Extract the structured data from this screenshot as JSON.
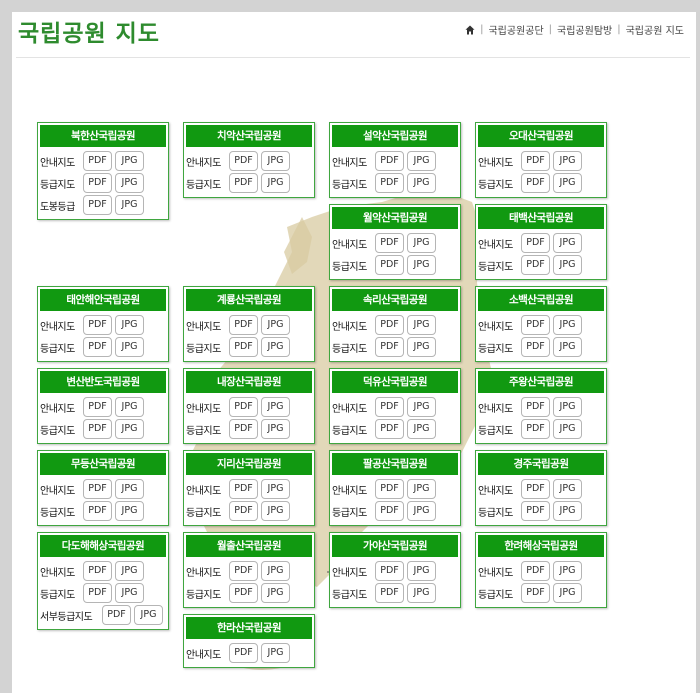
{
  "header": {
    "title": "국립공원 지도",
    "breadcrumbs": [
      "국립공원공단",
      "국립공원탐방",
      "국립공원 지도"
    ]
  },
  "colors": {
    "accent": "#119911",
    "title": "#2e8b2e",
    "map": "#d8cba2"
  },
  "parks": [
    {
      "name": "북한산국립공원",
      "rows": [
        {
          "label": "안내지도",
          "pdf": "PDF",
          "jpg": "JPG"
        },
        {
          "label": "등급지도",
          "pdf": "PDF",
          "jpg": "JPG"
        },
        {
          "label": "도봉등급",
          "pdf": "PDF",
          "jpg": "JPG"
        }
      ]
    },
    {
      "name": "치악산국립공원",
      "rows": [
        {
          "label": "안내지도",
          "pdf": "PDF",
          "jpg": "JPG"
        },
        {
          "label": "등급지도",
          "pdf": "PDF",
          "jpg": "JPG"
        }
      ]
    },
    {
      "name": "설악산국립공원",
      "rows": [
        {
          "label": "안내지도",
          "pdf": "PDF",
          "jpg": "JPG"
        },
        {
          "label": "등급지도",
          "pdf": "PDF",
          "jpg": "JPG"
        }
      ]
    },
    {
      "name": "오대산국립공원",
      "rows": [
        {
          "label": "안내지도",
          "pdf": "PDF",
          "jpg": "JPG"
        },
        {
          "label": "등급지도",
          "pdf": "PDF",
          "jpg": "JPG"
        }
      ]
    },
    {
      "name": "월악산국립공원",
      "rows": [
        {
          "label": "안내지도",
          "pdf": "PDF",
          "jpg": "JPG"
        },
        {
          "label": "등급지도",
          "pdf": "PDF",
          "jpg": "JPG"
        }
      ]
    },
    {
      "name": "태백산국립공원",
      "rows": [
        {
          "label": "안내지도",
          "pdf": "PDF",
          "jpg": "JPG"
        },
        {
          "label": "등급지도",
          "pdf": "PDF",
          "jpg": "JPG"
        }
      ]
    },
    {
      "name": "태안해안국립공원",
      "rows": [
        {
          "label": "안내지도",
          "pdf": "PDF",
          "jpg": "JPG"
        },
        {
          "label": "등급지도",
          "pdf": "PDF",
          "jpg": "JPG"
        }
      ]
    },
    {
      "name": "계룡산국립공원",
      "rows": [
        {
          "label": "안내지도",
          "pdf": "PDF",
          "jpg": "JPG"
        },
        {
          "label": "등급지도",
          "pdf": "PDF",
          "jpg": "JPG"
        }
      ]
    },
    {
      "name": "속리산국립공원",
      "rows": [
        {
          "label": "안내지도",
          "pdf": "PDF",
          "jpg": "JPG"
        },
        {
          "label": "등급지도",
          "pdf": "PDF",
          "jpg": "JPG"
        }
      ]
    },
    {
      "name": "소백산국립공원",
      "rows": [
        {
          "label": "안내지도",
          "pdf": "PDF",
          "jpg": "JPG"
        },
        {
          "label": "등급지도",
          "pdf": "PDF",
          "jpg": "JPG"
        }
      ]
    },
    {
      "name": "변산반도국립공원",
      "rows": [
        {
          "label": "안내지도",
          "pdf": "PDF",
          "jpg": "JPG"
        },
        {
          "label": "등급지도",
          "pdf": "PDF",
          "jpg": "JPG"
        }
      ]
    },
    {
      "name": "내장산국립공원",
      "rows": [
        {
          "label": "안내지도",
          "pdf": "PDF",
          "jpg": "JPG"
        },
        {
          "label": "등급지도",
          "pdf": "PDF",
          "jpg": "JPG"
        }
      ]
    },
    {
      "name": "덕유산국립공원",
      "rows": [
        {
          "label": "안내지도",
          "pdf": "PDF",
          "jpg": "JPG"
        },
        {
          "label": "등급지도",
          "pdf": "PDF",
          "jpg": "JPG"
        }
      ]
    },
    {
      "name": "주왕산국립공원",
      "rows": [
        {
          "label": "안내지도",
          "pdf": "PDF",
          "jpg": "JPG"
        },
        {
          "label": "등급지도",
          "pdf": "PDF",
          "jpg": "JPG"
        }
      ]
    },
    {
      "name": "무등산국립공원",
      "rows": [
        {
          "label": "안내지도",
          "pdf": "PDF",
          "jpg": "JPG"
        },
        {
          "label": "등급지도",
          "pdf": "PDF",
          "jpg": "JPG"
        }
      ]
    },
    {
      "name": "지리산국립공원",
      "rows": [
        {
          "label": "안내지도",
          "pdf": "PDF",
          "jpg": "JPG"
        },
        {
          "label": "등급지도",
          "pdf": "PDF",
          "jpg": "JPG"
        }
      ]
    },
    {
      "name": "팔공산국립공원",
      "rows": [
        {
          "label": "안내지도",
          "pdf": "PDF",
          "jpg": "JPG"
        },
        {
          "label": "등급지도",
          "pdf": "PDF",
          "jpg": "JPG"
        }
      ]
    },
    {
      "name": "경주국립공원",
      "rows": [
        {
          "label": "안내지도",
          "pdf": "PDF",
          "jpg": "JPG"
        },
        {
          "label": "등급지도",
          "pdf": "PDF",
          "jpg": "JPG"
        }
      ]
    },
    {
      "name": "다도해해상국립공원",
      "rows": [
        {
          "label": "안내지도",
          "pdf": "PDF",
          "jpg": "JPG"
        },
        {
          "label": "등급지도",
          "pdf": "PDF",
          "jpg": "JPG"
        },
        {
          "label": "서부등급지도",
          "pdf": "PDF",
          "jpg": "JPG"
        }
      ]
    },
    {
      "name": "월출산국립공원",
      "rows": [
        {
          "label": "안내지도",
          "pdf": "PDF",
          "jpg": "JPG"
        },
        {
          "label": "등급지도",
          "pdf": "PDF",
          "jpg": "JPG"
        }
      ]
    },
    {
      "name": "가야산국립공원",
      "rows": [
        {
          "label": "안내지도",
          "pdf": "PDF",
          "jpg": "JPG"
        },
        {
          "label": "등급지도",
          "pdf": "PDF",
          "jpg": "JPG"
        }
      ]
    },
    {
      "name": "한려해상국립공원",
      "rows": [
        {
          "label": "안내지도",
          "pdf": "PDF",
          "jpg": "JPG"
        },
        {
          "label": "등급지도",
          "pdf": "PDF",
          "jpg": "JPG"
        }
      ]
    },
    {
      "name": "한라산국립공원",
      "rows": [
        {
          "label": "안내지도",
          "pdf": "PDF",
          "jpg": "JPG"
        }
      ]
    }
  ]
}
